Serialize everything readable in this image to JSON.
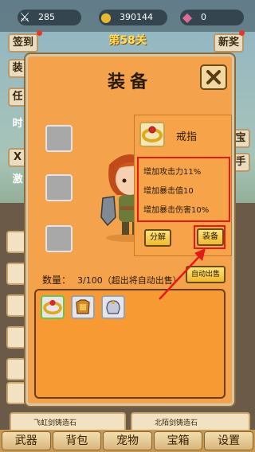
{
  "topbar": {
    "swords_count": "285",
    "coins_count": "390144",
    "gems_count": "0"
  },
  "side": {
    "checkin": "签到",
    "newbie": "新奖",
    "left_partial_1": "装",
    "left_partial_2": "任",
    "left_partial_3": "时",
    "left_partial_4": "X",
    "left_partial_5": "激",
    "right_partial_1": "宝",
    "right_partial_2": "手"
  },
  "stage_label": "第58关",
  "background_list": {
    "item_left": "飞虹剑铸造石",
    "item_right": "北陌剑铸造石"
  },
  "dialog": {
    "title": "装备",
    "info": {
      "name": "戒指",
      "stats": [
        "增加攻击力11%",
        "增加暴击值10",
        "增加暴击伤害10%"
      ],
      "decompose_label": "分解",
      "equip_label": "装备"
    },
    "count_label": "数量：",
    "count_value": "3/100（超出将自动出售）",
    "auto_sell_label": "自动出售"
  },
  "bottom_nav": [
    "武器",
    "背包",
    "宠物",
    "宝箱",
    "设置"
  ],
  "colors": {
    "dialog_bg": "#f5a24c",
    "highlight_red": "#e31a1a",
    "button_yellow": "#f0b830"
  }
}
